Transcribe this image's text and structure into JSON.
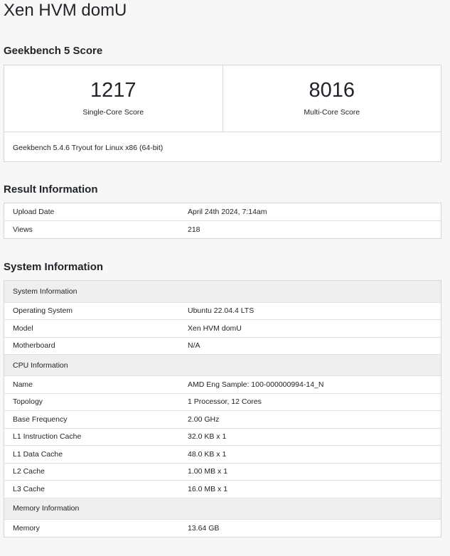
{
  "page_title": "Xen HVM domU",
  "geekbench": {
    "section_title": "Geekbench 5 Score",
    "single_core_value": "1217",
    "single_core_label": "Single-Core Score",
    "multi_core_value": "8016",
    "multi_core_label": "Multi-Core Score",
    "version": "Geekbench 5.4.6 Tryout for Linux x86 (64-bit)"
  },
  "result_info": {
    "section_title": "Result Information",
    "rows": [
      {
        "name": "Upload Date",
        "value": "April 24th 2024, 7:14am"
      },
      {
        "name": "Views",
        "value": "218"
      }
    ]
  },
  "system_info": {
    "section_title": "System Information",
    "groups": [
      {
        "header": "System Information",
        "rows": [
          {
            "name": "Operating System",
            "value": "Ubuntu 22.04.4 LTS"
          },
          {
            "name": "Model",
            "value": "Xen HVM domU"
          },
          {
            "name": "Motherboard",
            "value": "N/A"
          }
        ]
      },
      {
        "header": "CPU Information",
        "rows": [
          {
            "name": "Name",
            "value": "AMD Eng Sample: 100-000000994-14_N"
          },
          {
            "name": "Topology",
            "value": "1 Processor, 12 Cores"
          },
          {
            "name": "Base Frequency",
            "value": "2.00 GHz"
          },
          {
            "name": "L1 Instruction Cache",
            "value": "32.0 KB x 1"
          },
          {
            "name": "L1 Data Cache",
            "value": "48.0 KB x 1"
          },
          {
            "name": "L2 Cache",
            "value": "1.00 MB x 1"
          },
          {
            "name": "L3 Cache",
            "value": "16.0 MB x 1"
          }
        ]
      },
      {
        "header": "Memory Information",
        "rows": [
          {
            "name": "Memory",
            "value": "13.64 GB"
          }
        ]
      }
    ]
  }
}
